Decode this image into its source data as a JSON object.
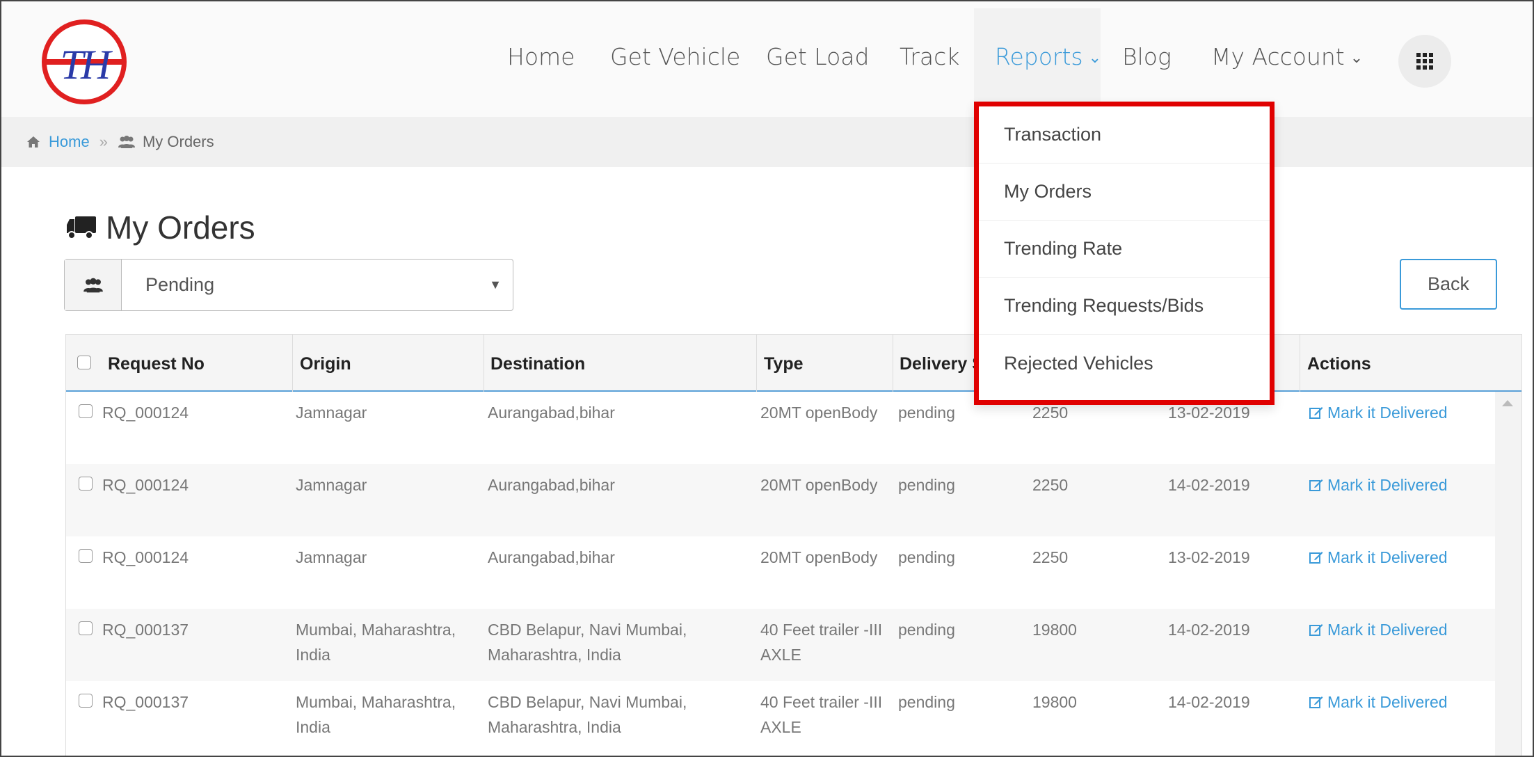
{
  "brand": {
    "logo_text": "TH"
  },
  "nav": {
    "items": [
      {
        "label": "Home"
      },
      {
        "label": "Get Vehicle"
      },
      {
        "label": "Get Load"
      },
      {
        "label": "Track"
      },
      {
        "label": "Reports",
        "active": true
      },
      {
        "label": "Blog"
      },
      {
        "label": "My Account"
      }
    ],
    "reports_chevron": "⌄",
    "account_chevron": "⌄"
  },
  "reports_menu": {
    "items": [
      "Transaction",
      "My Orders",
      "Trending Rate",
      "Trending Requests/Bids",
      "Rejected Vehicles"
    ]
  },
  "breadcrumb": {
    "home": "Home",
    "separator": "»",
    "current": "My Orders"
  },
  "page": {
    "title": "My Orders"
  },
  "filter": {
    "selected": "Pending",
    "caret": "▼"
  },
  "back_button": {
    "label": "Back"
  },
  "table": {
    "headers": [
      "Request No",
      "Origin",
      "Destination",
      "Type",
      "Delivery S",
      "Actions"
    ],
    "rows": [
      {
        "request_no": "RQ_000124",
        "origin": [
          "Jamnagar",
          ""
        ],
        "destination": [
          "Aurangabad,bihar",
          ""
        ],
        "type": [
          "20MT openBody",
          ""
        ],
        "status": "pending",
        "amount": "2250",
        "date": "13-02-2019",
        "action": "Mark it Delivered"
      },
      {
        "request_no": "RQ_000124",
        "origin": [
          "Jamnagar",
          ""
        ],
        "destination": [
          "Aurangabad,bihar",
          ""
        ],
        "type": [
          "20MT openBody",
          ""
        ],
        "status": "pending",
        "amount": "2250",
        "date": "14-02-2019",
        "action": "Mark it Delivered"
      },
      {
        "request_no": "RQ_000124",
        "origin": [
          "Jamnagar",
          ""
        ],
        "destination": [
          "Aurangabad,bihar",
          ""
        ],
        "type": [
          "20MT openBody",
          ""
        ],
        "status": "pending",
        "amount": "2250",
        "date": "13-02-2019",
        "action": "Mark it Delivered"
      },
      {
        "request_no": "RQ_000137",
        "origin": [
          "Mumbai, Maharashtra,",
          "India"
        ],
        "destination": [
          "CBD Belapur, Navi Mumbai,",
          "Maharashtra, India"
        ],
        "type": [
          "40 Feet trailer -III",
          "AXLE"
        ],
        "status": "pending",
        "amount": "19800",
        "date": "14-02-2019",
        "action": "Mark it Delivered"
      },
      {
        "request_no": "RQ_000137",
        "origin": [
          "Mumbai, Maharashtra,",
          "India"
        ],
        "destination": [
          "CBD Belapur, Navi Mumbai,",
          "Maharashtra, India"
        ],
        "type": [
          "40 Feet trailer -III",
          "AXLE"
        ],
        "status": "pending",
        "amount": "19800",
        "date": "14-02-2019",
        "action": "Mark it Delivered"
      }
    ]
  },
  "colors": {
    "accent": "#3a9ad9",
    "highlight": "#e00000",
    "logo_red": "#e02020",
    "logo_blue": "#2a3aa8"
  },
  "icons": [
    "home-icon",
    "users-icon",
    "truck-icon",
    "apps-grid-icon",
    "edit-icon",
    "chevron-down-icon"
  ]
}
